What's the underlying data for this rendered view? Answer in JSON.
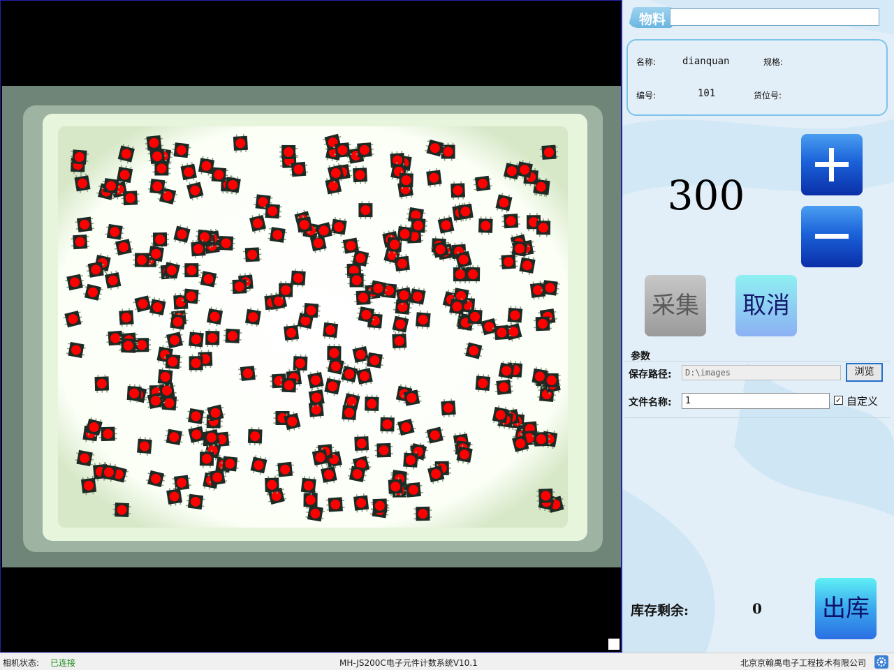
{
  "material": {
    "tag_label": "物料",
    "search_value": ""
  },
  "info": {
    "name_label": "名称:",
    "name_value": "dianquan",
    "spec_label": "规格:",
    "spec_value": "",
    "number_label": "编号:",
    "number_value": "101",
    "location_label": "货位号:",
    "location_value": ""
  },
  "counter": {
    "value": "300",
    "plus_icon": "plus-icon",
    "minus_icon": "minus-icon"
  },
  "actions": {
    "capture_label": "采集",
    "cancel_label": "取消"
  },
  "params": {
    "title": "参数",
    "path_label": "保存路径:",
    "path_value": "D:\\images",
    "browse_label": "浏览",
    "filename_label": "文件名称:",
    "filename_value": "1",
    "custom_checked": true,
    "custom_label": "自定义"
  },
  "stock": {
    "label": "库存剩余:",
    "value": "0",
    "outbound_label": "出库"
  },
  "statusbar": {
    "camera_label": "相机状态:",
    "camera_value": "已连接",
    "app_title": "MH-JS200C电子元件计数系统V10.1",
    "company": "北京京翰禹电子工程技术有限公司",
    "settings_icon": "gear-icon"
  },
  "colors": {
    "accent_blue": "#1b62d9",
    "detect_marker": "#ff0000",
    "connected_green": "#1a8a1a"
  }
}
